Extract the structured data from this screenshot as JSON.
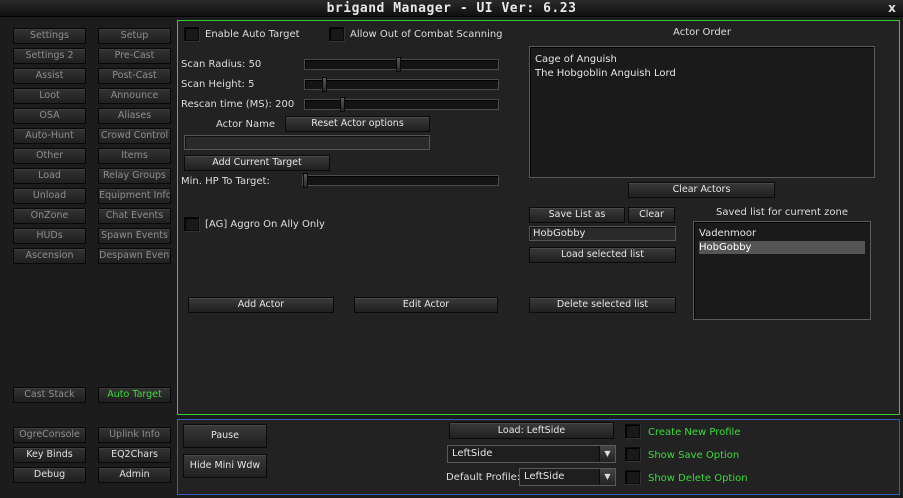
{
  "window": {
    "title": "brigand Manager  - UI Ver: 6.23",
    "close_label": "x"
  },
  "nav": {
    "left": [
      "Settings",
      "Settings 2",
      "Assist",
      "Loot",
      "OSA",
      "Auto-Hunt",
      "Other",
      "Load",
      "Unload",
      "OnZone",
      "HUDs",
      "Ascension"
    ],
    "right": [
      "Setup",
      "Pre-Cast",
      "Post-Cast",
      "Announce",
      "Aliases",
      "Crowd Control",
      "Items",
      "Relay Groups",
      "Equipment Info",
      "Chat Events",
      "Spawn Events",
      "Despawn Event"
    ],
    "cast_stack": "Cast Stack",
    "auto_target": "Auto Target",
    "bottom": [
      [
        "OgreConsole",
        "Uplink Info"
      ],
      [
        "Key Binds",
        "EQ2Chars"
      ],
      [
        "Debug",
        "Admin"
      ]
    ]
  },
  "main": {
    "enable_auto_target": "Enable Auto Target",
    "allow_ooc_scanning": "Allow Out of Combat Scanning",
    "scan_radius": {
      "label": "Scan Radius: 50",
      "value": 0.49
    },
    "scan_height": {
      "label": "Scan Height: 5",
      "value": 0.09
    },
    "rescan_time": {
      "label": "Rescan time (MS): 200",
      "value": 0.19
    },
    "actor_name_label": "Actor Name",
    "reset_actor_options": "Reset Actor options",
    "actor_name_value": "",
    "add_current_target": "Add Current Target",
    "min_hp": {
      "label": "Min. HP To Target:",
      "value": 0.0
    },
    "aggro_on_ally": "[AG] Aggro On Ally Only",
    "add_actor": "Add Actor",
    "edit_actor": "Edit Actor",
    "actor_order": {
      "title": "Actor Order",
      "items": [
        "Cage of Anguish",
        "The Hobgoblin Anguish Lord"
      ],
      "clear_actors": "Clear Actors"
    },
    "save_list_as": "Save List as",
    "clear": "Clear",
    "save_name_value": "HobGobby",
    "load_selected_list": "Load selected list",
    "delete_selected_list": "Delete selected list",
    "saved_list": {
      "title": "Saved list for current zone",
      "items": [
        "Vadenmoor",
        "HobGobby"
      ],
      "selected_index": 1
    }
  },
  "bottom": {
    "pause": "Pause",
    "hide_mini": "Hide Mini Wdw",
    "load_profile": "Load: LeftSide",
    "profile_select": "LeftSide",
    "default_profile_label": "Default Profile:",
    "default_profile_value": "LeftSide",
    "create_new_profile": "Create New Profile",
    "show_save_option": "Show Save Option",
    "show_delete_option": "Show Delete Option"
  },
  "colors": {
    "green_accent": "#2fcf2f",
    "blue_accent": "#2f5fbf",
    "green_text": "#3bdc3b"
  },
  "icons": {
    "close": "close-icon",
    "dropdown": "chevron-down-icon"
  }
}
